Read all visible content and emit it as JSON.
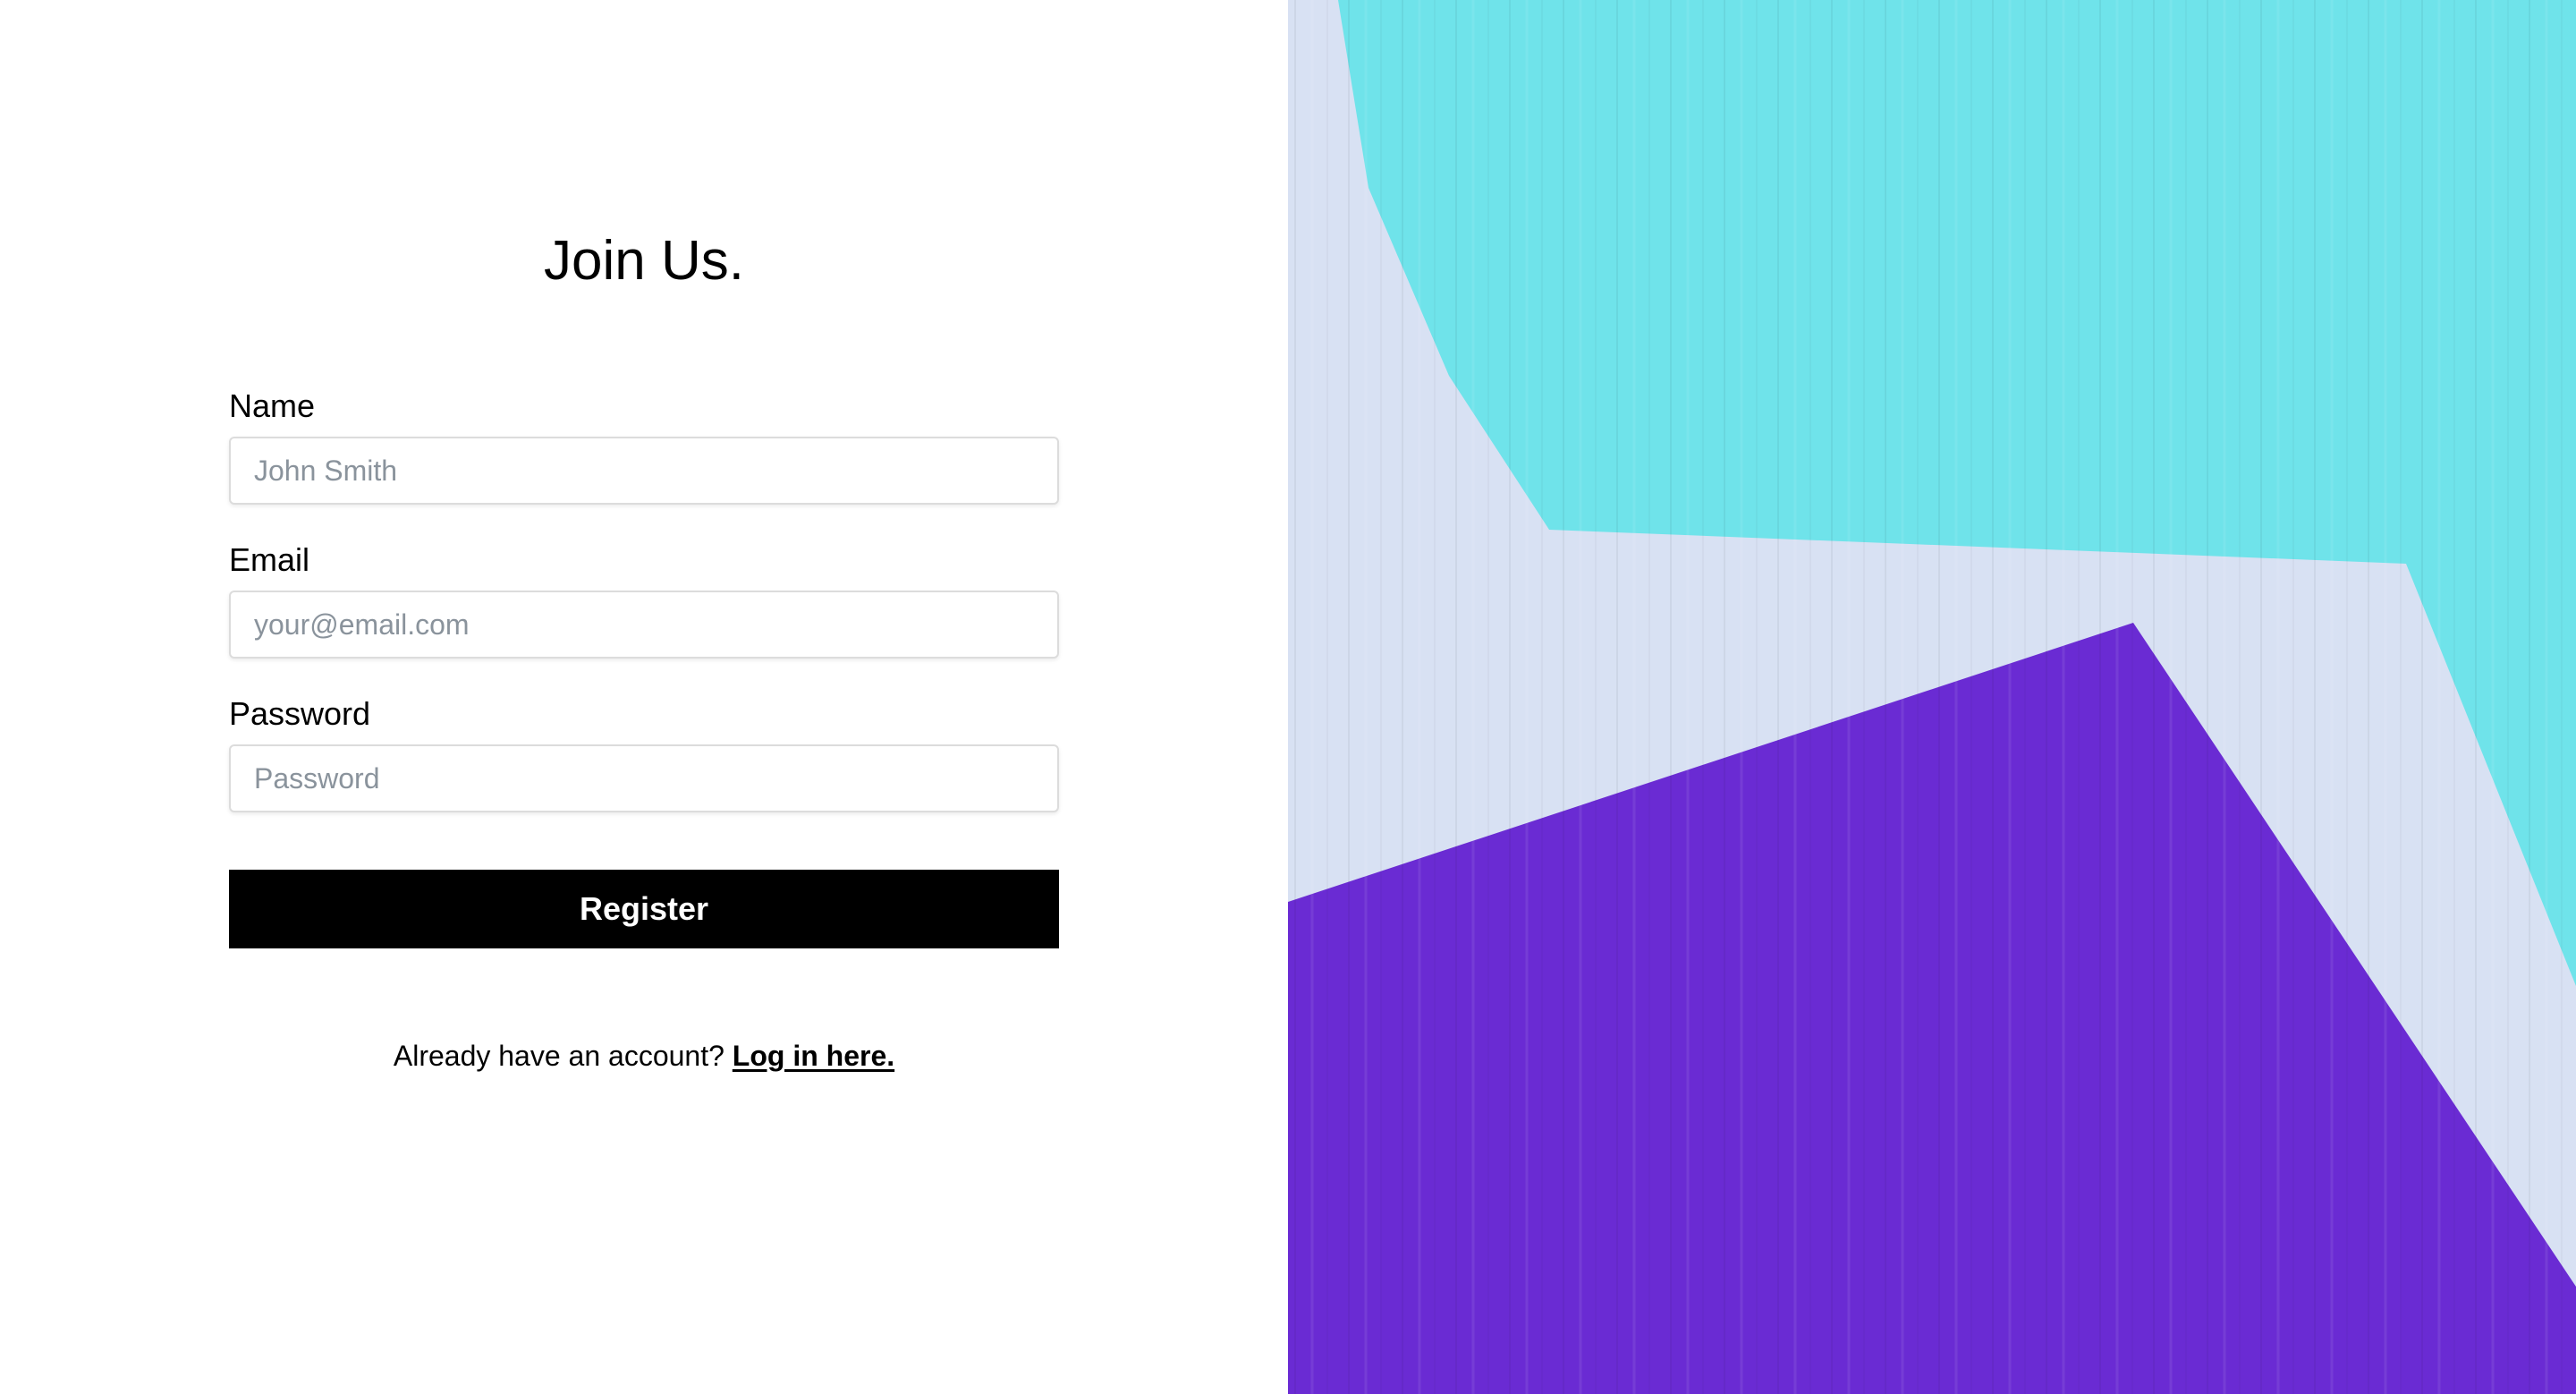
{
  "form": {
    "title": "Join Us.",
    "fields": [
      {
        "label": "Name",
        "placeholder": "John Smith",
        "value": ""
      },
      {
        "label": "Email",
        "placeholder": "your@email.com",
        "value": ""
      },
      {
        "label": "Password",
        "placeholder": "Password",
        "value": ""
      }
    ],
    "submit_label": "Register",
    "login_prompt": "Already have an account?",
    "login_link": "Log in here."
  },
  "hero": {
    "colors": {
      "cyan": "#6fe3ea",
      "pale": "#d8e1f3",
      "purple": "#6a2bd3"
    }
  }
}
